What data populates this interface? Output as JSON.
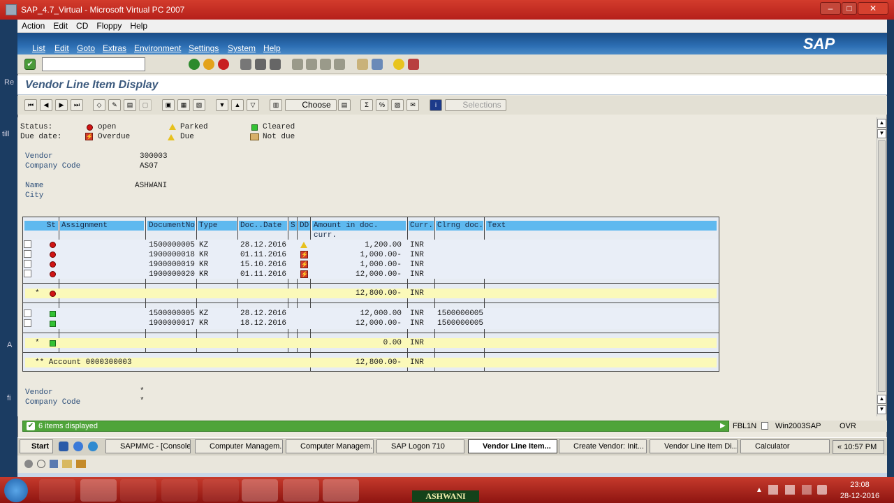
{
  "host": {
    "title": "SAP_4.7_Virtual - Microsoft Virtual PC 2007",
    "menu": [
      "Action",
      "Edit",
      "CD",
      "Floppy",
      "Help"
    ],
    "left_labels": [
      "Re",
      "till",
      "A",
      "fi"
    ]
  },
  "sap": {
    "menu": [
      "List",
      "Edit",
      "Goto",
      "Extras",
      "Environment",
      "Settings",
      "System",
      "Help"
    ],
    "logo": "SAP",
    "title": "Vendor Line Item Display",
    "toolbar2": {
      "choose": "Choose",
      "selections": "Selections"
    },
    "legend": {
      "status_label": "Status:",
      "duedate_label": "Due date:",
      "open": "open",
      "parked": "Parked",
      "cleared": "Cleared",
      "overdue": "Overdue",
      "due": "Due",
      "notdue": "Not due"
    },
    "header": {
      "vendor_label": "Vendor",
      "vendor": "300003",
      "cc_label": "Company Code",
      "cc": "AS07",
      "name_label": "Name",
      "name": "ASHWANI",
      "city_label": "City"
    },
    "table": {
      "columns": [
        "St",
        "Assignment",
        "DocumentNo",
        "Type",
        "Doc..Date",
        "S",
        "DD",
        "Amount in doc. curr.",
        "Curr.",
        "Clrng doc.",
        "Text"
      ],
      "open_rows": [
        {
          "doc": "1500000005",
          "type": "KZ",
          "date": "28.12.2016",
          "amount": "1,200.00",
          "curr": "INR",
          "dd": "due"
        },
        {
          "doc": "1900000018",
          "type": "KR",
          "date": "01.11.2016",
          "amount": "1,000.00-",
          "curr": "INR",
          "dd": "overdue"
        },
        {
          "doc": "1900000019",
          "type": "KR",
          "date": "15.10.2016",
          "amount": "1,000.00-",
          "curr": "INR",
          "dd": "overdue"
        },
        {
          "doc": "1900000020",
          "type": "KR",
          "date": "01.11.2016",
          "amount": "12,000.00-",
          "curr": "INR",
          "dd": "overdue"
        }
      ],
      "open_total": {
        "mark": "*",
        "amount": "12,800.00-",
        "curr": "INR"
      },
      "cleared_rows": [
        {
          "doc": "1500000005",
          "type": "KZ",
          "date": "28.12.2016",
          "amount": "12,000.00",
          "curr": "INR",
          "clrng": "1500000005"
        },
        {
          "doc": "1900000017",
          "type": "KR",
          "date": "18.12.2016",
          "amount": "12,000.00-",
          "curr": "INR",
          "clrng": "1500000005"
        }
      ],
      "cleared_total": {
        "mark": "*",
        "amount": "0.00",
        "curr": "INR"
      },
      "account_total": {
        "label": "** Account 0000300003",
        "amount": "12,800.00-",
        "curr": "INR"
      }
    },
    "footer": {
      "vendor_label": "Vendor",
      "vendor": "*",
      "cc_label": "Company Code",
      "cc": "*"
    },
    "status": {
      "message": "6 items displayed",
      "tcode": "FBL1N",
      "server": "Win2003SAP",
      "mode": "OVR"
    }
  },
  "inner_taskbar": {
    "start": "Start",
    "items": [
      "SAPMMC - [Console...",
      "Computer Managem...",
      "Computer Managem...",
      "SAP Logon 710",
      "Vendor Line Item...",
      "Create Vendor:  Init...",
      "Vendor Line Item Di...",
      "Calculator"
    ],
    "clock": "10:57 PM"
  },
  "win7": {
    "clock_time": "23:08",
    "clock_date": "28-12-2016",
    "overlay": "ASHWANI"
  },
  "colors": {
    "status_green": "#4fa43a",
    "header_blue": "#5eb9ef",
    "total_yellow": "#fbf9b9",
    "sap_blue": "#1a4c86"
  }
}
